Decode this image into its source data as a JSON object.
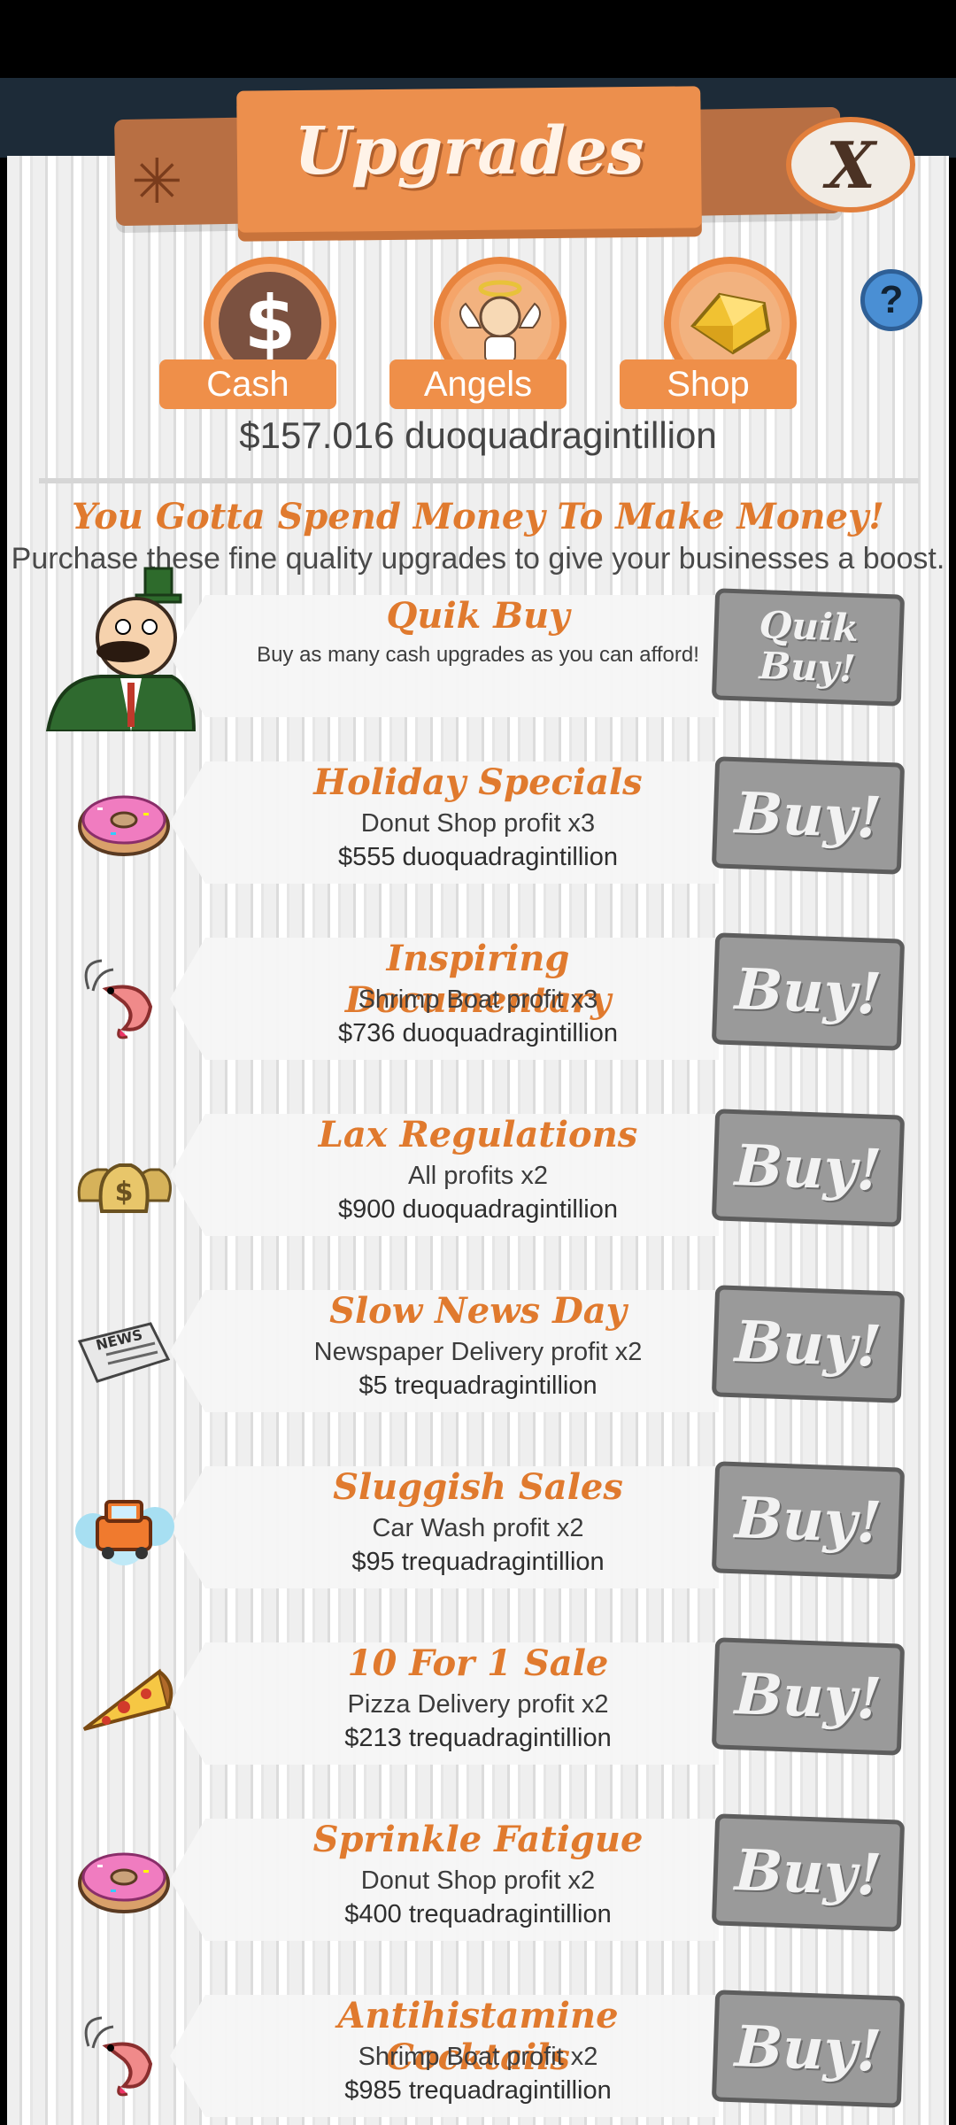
{
  "header": {
    "title": "Upgrades",
    "close_label": "X",
    "help_label": "?"
  },
  "tabs": [
    {
      "label": "Cash",
      "icon": "dollar-icon"
    },
    {
      "label": "Angels",
      "icon": "angel-icon"
    },
    {
      "label": "Shop",
      "icon": "gold-gem-icon"
    }
  ],
  "balance": "$157.016 duoquadragintillion",
  "intro": {
    "headline": "You Gotta Spend Money To Make Money!",
    "subline": "Purchase these fine quality upgrades to give your businesses a boost."
  },
  "quik_buy": {
    "name": "Quik Buy",
    "desc": "Buy as many cash upgrades as you can afford!",
    "button_label": "Quik Buy!"
  },
  "upgrades": [
    {
      "name": "Holiday Specials",
      "desc": "Donut Shop profit x3",
      "cost": "$555 duoquadragintillion",
      "icon": "donut-icon",
      "button_label": "Buy!"
    },
    {
      "name": "Inspiring Documentary",
      "desc": "Shrimp Boat profit x3",
      "cost": "$736 duoquadragintillion",
      "icon": "shrimp-icon",
      "button_label": "Buy!"
    },
    {
      "name": "Lax Regulations",
      "desc": "All profits x2",
      "cost": "$900 duoquadragintillion",
      "icon": "money-bags-icon",
      "button_label": "Buy!"
    },
    {
      "name": "Slow News Day",
      "desc": "Newspaper Delivery profit x2",
      "cost": "$5 trequadragintillion",
      "icon": "newspaper-icon",
      "button_label": "Buy!"
    },
    {
      "name": "Sluggish Sales",
      "desc": "Car Wash profit x2",
      "cost": "$95 trequadragintillion",
      "icon": "car-wash-icon",
      "button_label": "Buy!"
    },
    {
      "name": "10 For 1 Sale",
      "desc": "Pizza Delivery profit x2",
      "cost": "$213 trequadragintillion",
      "icon": "pizza-icon",
      "button_label": "Buy!"
    },
    {
      "name": "Sprinkle Fatigue",
      "desc": "Donut Shop profit x2",
      "cost": "$400 trequadragintillion",
      "icon": "donut-icon",
      "button_label": "Buy!"
    },
    {
      "name": "Antihistamine Cocktails",
      "desc": "Shrimp Boat profit x2",
      "cost": "$985 trequadragintillion",
      "icon": "shrimp-icon",
      "button_label": "Buy!"
    }
  ],
  "colors": {
    "accent": "#e07a2e",
    "button_grey": "#9a9a9a",
    "tab_orange": "#ef8f49"
  }
}
